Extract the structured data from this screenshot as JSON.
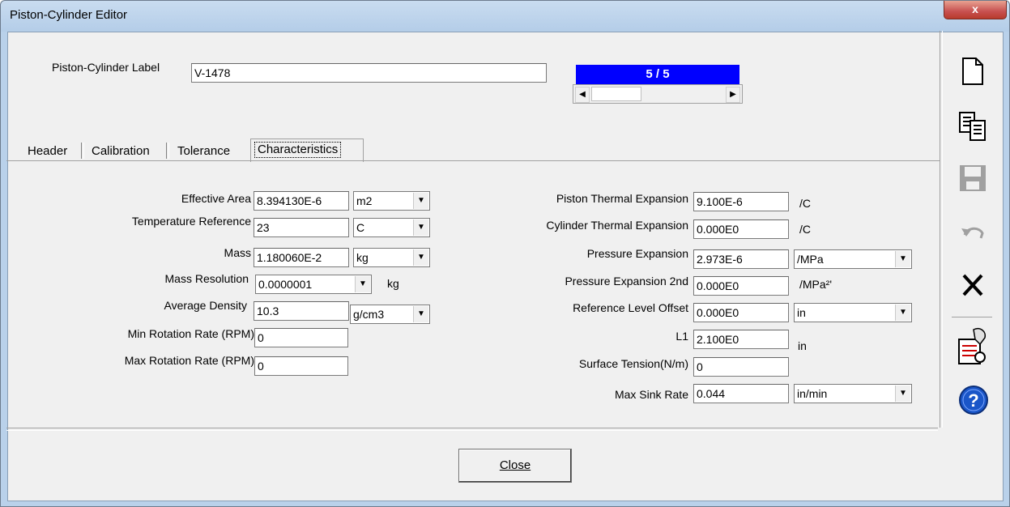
{
  "window": {
    "title": "Piston-Cylinder Editor",
    "close_glyph": "x"
  },
  "label_row": {
    "label": "Piston-Cylinder Label",
    "value": "V-1478"
  },
  "navigator": {
    "counter": "5 / 5",
    "left_arrow": "◀",
    "right_arrow": "▶"
  },
  "tabs": [
    {
      "label": "Header"
    },
    {
      "label": "Calibration"
    },
    {
      "label": "Tolerance"
    },
    {
      "label": "Characteristics",
      "active": true
    }
  ],
  "left_fields": {
    "effective_area": {
      "label": "Effective Area",
      "value": "8.394130E-6",
      "unit": "m2"
    },
    "temperature_reference": {
      "label": "Temperature Reference",
      "value": "23",
      "unit": "C"
    },
    "mass": {
      "label": "Mass",
      "value": "1.180060E-2",
      "unit": "kg"
    },
    "mass_resolution": {
      "label": "Mass Resolution",
      "value": "0.0000001",
      "unit": "kg"
    },
    "average_density": {
      "label": "Average Density",
      "value": "10.3",
      "unit": "g/cm3"
    },
    "min_rotation": {
      "label": "Min Rotation Rate (RPM)",
      "value": "0"
    },
    "max_rotation": {
      "label": "Max Rotation Rate (RPM)",
      "value": "0"
    }
  },
  "right_fields": {
    "piston_thermal": {
      "label": "Piston Thermal Expansion",
      "value": "9.100E-6",
      "unit": "/C"
    },
    "cylinder_thermal": {
      "label": "Cylinder Thermal Expansion",
      "value": "0.000E0",
      "unit": "/C"
    },
    "pressure_expansion": {
      "label": "Pressure Expansion",
      "value": "2.973E-6",
      "unit": "/MPa"
    },
    "pressure_expansion_2nd": {
      "label": "Pressure Expansion 2nd",
      "value": "0.000E0",
      "unit": "/MPa²'"
    },
    "reference_offset": {
      "label": "Reference Level Offset",
      "value": "0.000E0",
      "unit": "in"
    },
    "l1": {
      "label": "L1",
      "value": "2.100E0",
      "unit": "in"
    },
    "surface_tension": {
      "label": "Surface Tension(N/m)",
      "value": "0"
    },
    "max_sink_rate": {
      "label": "Max Sink Rate",
      "value": "0.044",
      "unit": "in/min"
    }
  },
  "dropdown_arrow": "▼",
  "buttons": {
    "close": "Close"
  },
  "toolbar": [
    "new-document-icon",
    "copy-icon",
    "save-icon",
    "undo-icon",
    "delete-icon",
    "settings-icon",
    "help-icon"
  ],
  "colors": {
    "accent": "#0000ff",
    "help": "#1a56c8",
    "delete": "#000000"
  }
}
